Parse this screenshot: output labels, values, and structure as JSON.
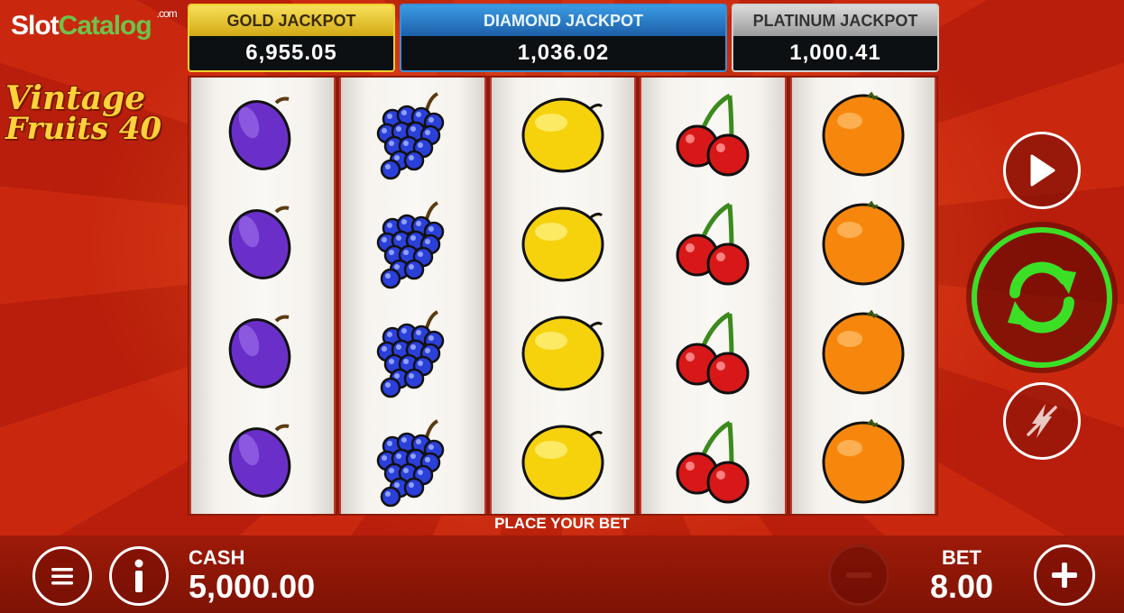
{
  "brand": {
    "name_part1": "Slot",
    "name_part2": "Catalog",
    "suffix": ".com"
  },
  "logo": {
    "line1": "Vintage",
    "line2": "Fruits 40"
  },
  "jackpots": [
    {
      "title": "GOLD JACKPOT",
      "value": "6,955.05"
    },
    {
      "title": "DIAMOND JACKPOT",
      "value": "1,036.02"
    },
    {
      "title": "PLATINUM JACKPOT",
      "value": "1,000.41"
    }
  ],
  "reels": [
    [
      "plum",
      "plum",
      "plum",
      "plum"
    ],
    [
      "grapes",
      "grapes",
      "grapes",
      "grapes"
    ],
    [
      "lemon",
      "lemon",
      "lemon",
      "lemon"
    ],
    [
      "cherry",
      "cherry",
      "cherry",
      "cherry"
    ],
    [
      "orange",
      "orange",
      "orange",
      "orange"
    ]
  ],
  "status": {
    "message": "PLACE YOUR BET"
  },
  "cash": {
    "label": "CASH",
    "value": "5,000.00"
  },
  "bet": {
    "label": "BET",
    "value": "8.00"
  },
  "controls": {
    "play_icon": "play-icon",
    "spin_icon": "refresh-icon",
    "turbo_icon": "turbo-off-icon",
    "menu_icon": "hamburger-icon",
    "info_icon": "info-icon",
    "minus_icon": "minus-icon",
    "plus_icon": "plus-icon"
  },
  "colors": {
    "spin_ring": "#3be026",
    "background": "#b8200e"
  }
}
